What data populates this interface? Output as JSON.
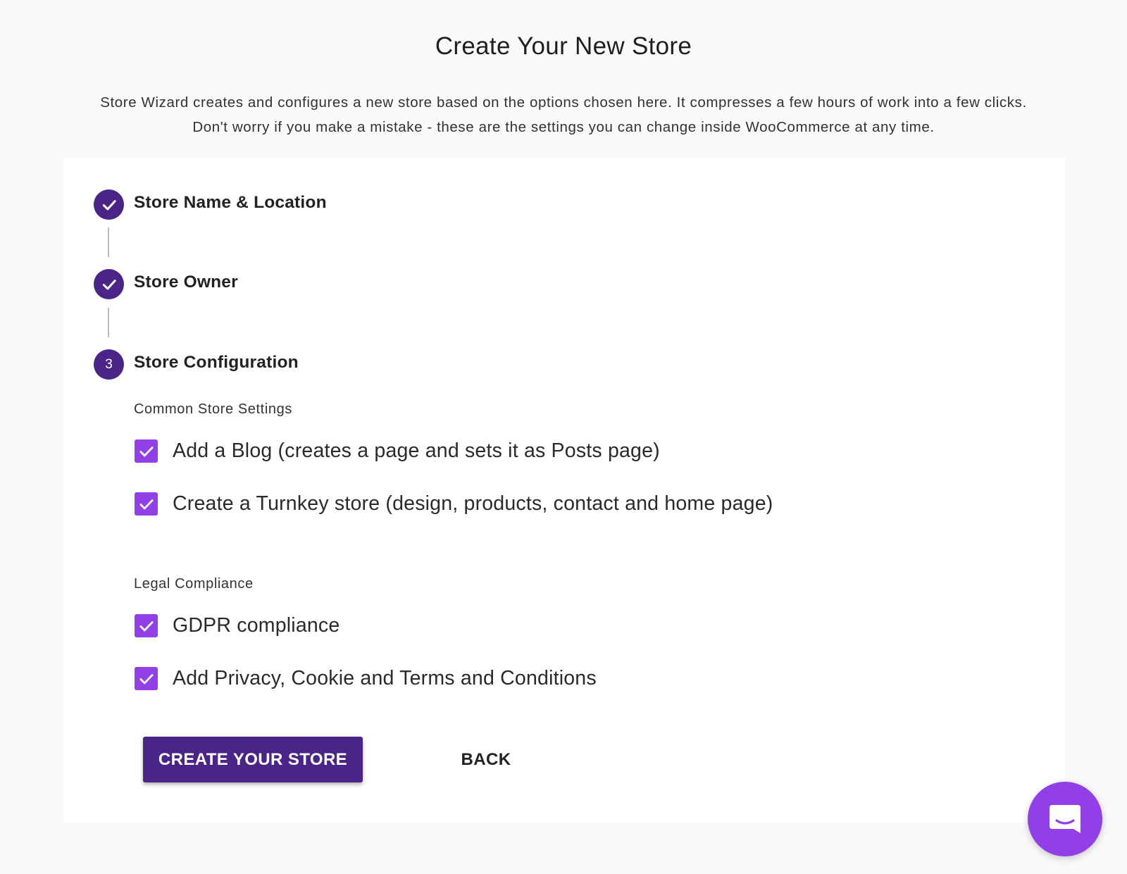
{
  "header": {
    "title": "Create Your New Store",
    "intro_line1": "Store Wizard creates and configures a new store based on the options chosen here. It compresses a few hours of work into a few clicks.",
    "intro_line2": "Don't worry if you make a mistake - these are the settings you can change inside WooCommerce at any time."
  },
  "steps": [
    {
      "label": "Store Name & Location",
      "status": "completed",
      "icon": "check-icon"
    },
    {
      "label": "Store Owner",
      "status": "completed",
      "icon": "check-icon"
    },
    {
      "label": "Store Configuration",
      "status": "active",
      "number": "3"
    }
  ],
  "sections": {
    "common": {
      "heading": "Common Store Settings",
      "options": [
        {
          "label": "Add a Blog (creates a page and sets it as Posts page)",
          "checked": true
        },
        {
          "label": "Create a Turnkey store (design, products, contact and home page)",
          "checked": true
        }
      ]
    },
    "legal": {
      "heading": "Legal Compliance",
      "options": [
        {
          "label": "GDPR compliance",
          "checked": true
        },
        {
          "label": "Add Privacy, Cookie and Terms and Conditions",
          "checked": true
        }
      ]
    }
  },
  "actions": {
    "create_label": "CREATE YOUR STORE",
    "back_label": "BACK"
  },
  "chat": {
    "icon": "chat-icon"
  },
  "colors": {
    "primary": "#4a2587",
    "checkbox": "#9140e8",
    "chat": "#9140e8",
    "background": "#f9f9f9",
    "card": "#ffffff"
  }
}
